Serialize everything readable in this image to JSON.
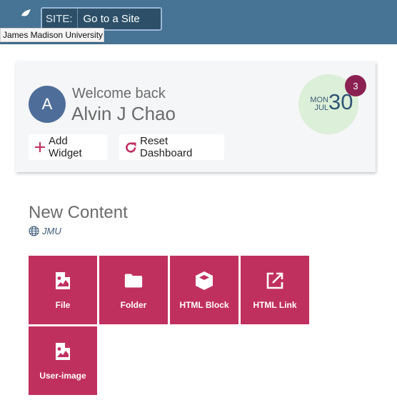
{
  "header": {
    "logo_icon": "jmu-crescent-logo-icon",
    "site_label": "SITE:",
    "site_value": "Go to a Site",
    "tooltip": "James Madison University",
    "background_color": "#477494"
  },
  "dashboard_card": {
    "avatar_initial": "A",
    "welcome_text": "Welcome back",
    "user_name": "Alvin J Chao",
    "buttons": [
      {
        "label": "Add Widget",
        "icon": "plus-icon"
      },
      {
        "label": "Reset Dashboard",
        "icon": "refresh-icon"
      }
    ],
    "date": {
      "day_of_week": "MON",
      "month": "JUL",
      "day": "30"
    },
    "notification_count": "3"
  },
  "new_content": {
    "title": "New Content",
    "site": "JMU",
    "site_icon": "globe-icon",
    "accent_color": "#c0305e",
    "tiles": [
      {
        "label": "File",
        "icon": "file-image-icon"
      },
      {
        "label": "Folder",
        "icon": "folder-icon"
      },
      {
        "label": "HTML Block",
        "icon": "cube-icon"
      },
      {
        "label": "HTML Link",
        "icon": "external-link-icon"
      },
      {
        "label": "User-image",
        "icon": "file-image-icon"
      }
    ]
  }
}
